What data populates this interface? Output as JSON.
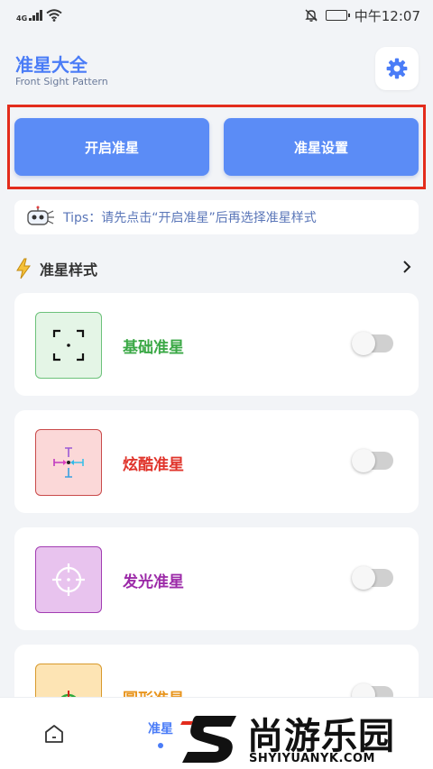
{
  "status_bar": {
    "network": "4G",
    "time": "中午12:07"
  },
  "header": {
    "title": "准星大全",
    "subtitle": "Front Sight Pattern"
  },
  "buttons": {
    "start_label": "开启准星",
    "settings_label": "准星设置"
  },
  "tips": {
    "text": "Tips：请先点击“开启准星”后再选择准星样式"
  },
  "section": {
    "title": "准星样式"
  },
  "crosshairs": [
    {
      "label": "基础准星",
      "label_color": "#3aa845",
      "thumb_bg": "#e4f5e6",
      "thumb_border": "#6cc27a",
      "enabled": false
    },
    {
      "label": "炫酷准星",
      "label_color": "#e0342b",
      "thumb_bg": "#fbd8d8",
      "thumb_border": "#c94a4a",
      "enabled": false
    },
    {
      "label": "发光准星",
      "label_color": "#9c2aa8",
      "thumb_bg": "#e8c3ee",
      "thumb_border": "#a23db2",
      "enabled": false
    },
    {
      "label": "圆形准星",
      "label_color": "#e8941c",
      "thumb_bg": "#fde4b4",
      "thumb_border": "#d89a2c",
      "enabled": false
    }
  ],
  "bottom_nav": {
    "active_label": "准星"
  },
  "watermark": {
    "name_cn": "尚游乐园",
    "name_en": "SHYIYUANYK.COM"
  },
  "colors": {
    "accent": "#4a7cf7",
    "button": "#5b8cf6",
    "highlight_border": "#e32c1c"
  }
}
